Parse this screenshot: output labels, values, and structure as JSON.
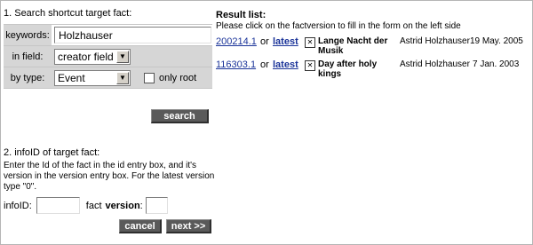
{
  "search": {
    "heading": "1. Search shortcut target fact:",
    "keywords_label": "keywords:",
    "keywords_value": "Holzhauser",
    "field_label": "in field:",
    "field_value": "creator field",
    "type_label": "by type:",
    "type_value": "Event",
    "only_root_label": "only root",
    "search_button": "search"
  },
  "infoid": {
    "heading": "2. infoID of target fact:",
    "help": "Enter the Id of the fact in the id entry box, and it's version in the version entry box. For the latest version type \"0\".",
    "infoid_label": "infoID:",
    "fact_label": "fact",
    "version_label": "version",
    "version_colon": ":",
    "cancel_button": "cancel",
    "next_button": "next >>"
  },
  "results": {
    "title": "Result list:",
    "help": "Please click on the factversion to fill in the form on the left side",
    "rows": [
      {
        "version": "200214.1",
        "or": "or",
        "latest": "latest",
        "title": "Lange Nacht der Musik",
        "author": "Astrid Holzhauser",
        "date": "19 May. 2005"
      },
      {
        "version": "116303.1",
        "or": "or",
        "latest": "latest",
        "title": "Day after holy kings",
        "author": "Astrid Holzhauser",
        "date": "7 Jan. 2003"
      }
    ]
  }
}
